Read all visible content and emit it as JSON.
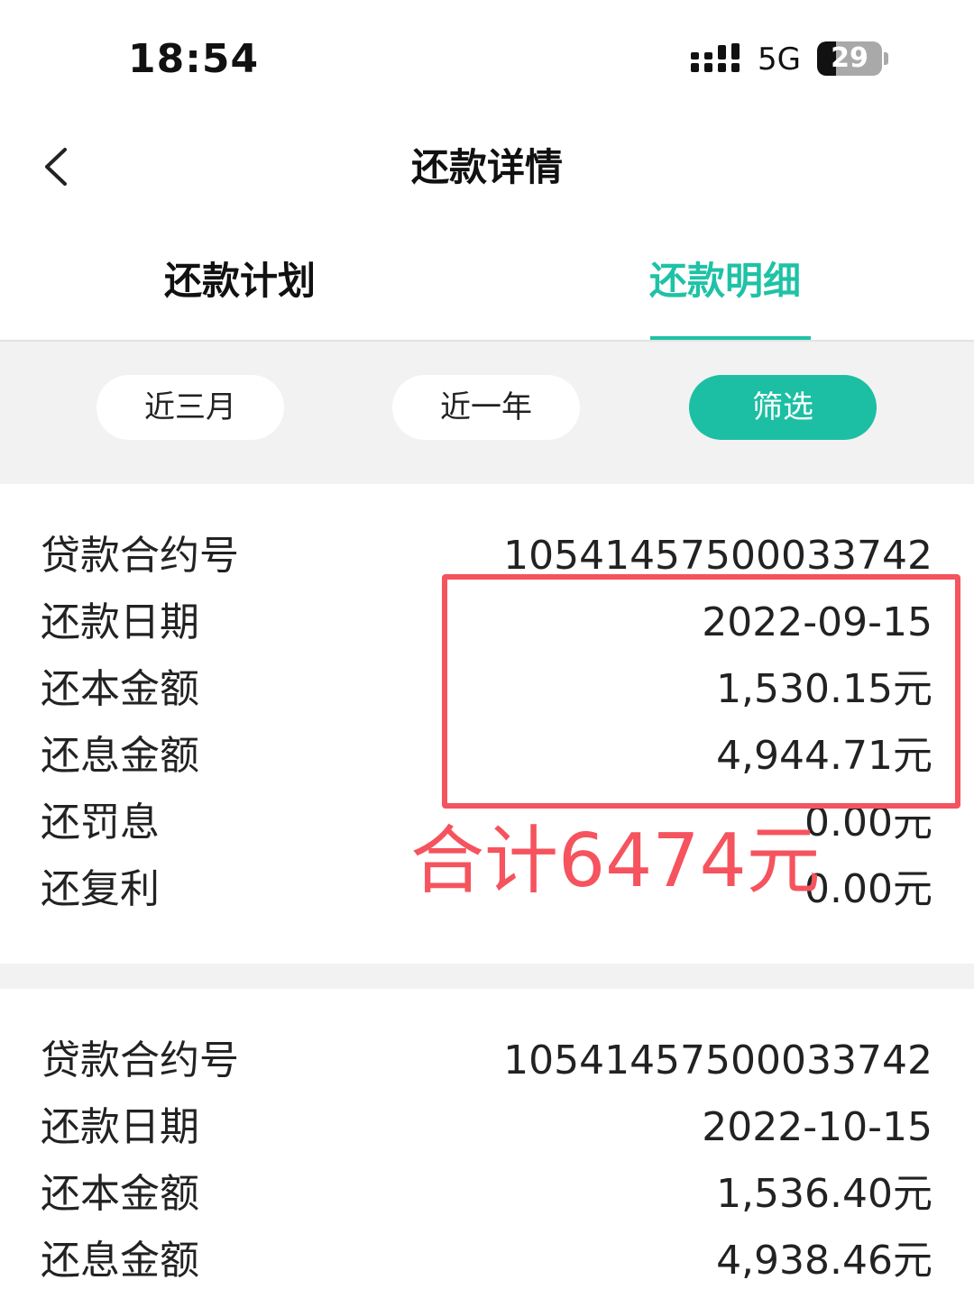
{
  "status_bar": {
    "time": "18:54",
    "network": "5G",
    "battery": "29",
    "battery_level": 0.29
  },
  "nav": {
    "title": "还款详情"
  },
  "tabs": [
    {
      "label": "还款计划",
      "active": false
    },
    {
      "label": "还款明细",
      "active": true
    }
  ],
  "filters": [
    {
      "label": "近三月",
      "selected": false
    },
    {
      "label": "近一年",
      "selected": false
    },
    {
      "label": "筛选",
      "selected": true
    }
  ],
  "records": [
    {
      "rows": [
        {
          "label": "贷款合约号",
          "value": "10541457500033742"
        },
        {
          "label": "还款日期",
          "value": "2022-09-15"
        },
        {
          "label": "还本金额",
          "value": "1,530.15元"
        },
        {
          "label": "还息金额",
          "value": "4,944.71元"
        },
        {
          "label": "还罚息",
          "value": "0.00元"
        },
        {
          "label": "还复利",
          "value": "0.00元"
        }
      ]
    },
    {
      "rows": [
        {
          "label": "贷款合约号",
          "value": "10541457500033742"
        },
        {
          "label": "还款日期",
          "value": "2022-10-15"
        },
        {
          "label": "还本金额",
          "value": "1,536.40元"
        },
        {
          "label": "还息金额",
          "value": "4,938.46元"
        }
      ]
    }
  ],
  "annotation": {
    "text": "合计6474元",
    "color": "#f5535d"
  },
  "colors": {
    "accent": "#1fc2a6",
    "background_gray": "#f2f2f2"
  }
}
